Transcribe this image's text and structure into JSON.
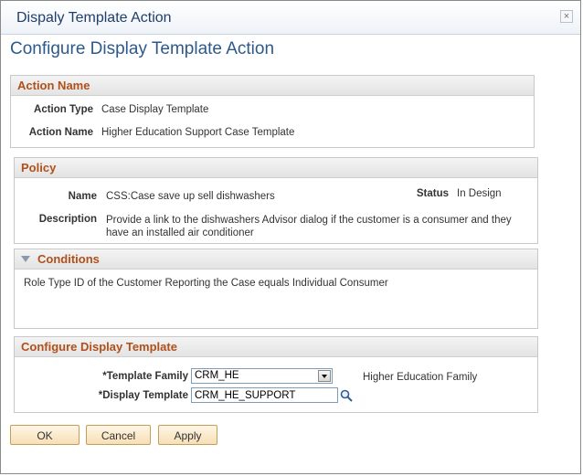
{
  "window": {
    "title": "Dispaly Template Action",
    "close_glyph": "×"
  },
  "page": {
    "title": "Configure Display Template Action"
  },
  "action_name_section": {
    "header": "Action Name",
    "action_type_label": "Action Type",
    "action_type_value": "Case Display Template",
    "action_name_label": "Action Name",
    "action_name_value": "Higher Education Support Case Template"
  },
  "policy_section": {
    "header": "Policy",
    "name_label": "Name",
    "name_value": "CSS:Case save up sell dishwashers",
    "status_label": "Status",
    "status_value": "In Design",
    "description_label": "Description",
    "description_value": "Provide a link to the dishwashers Advisor dialog if the customer is a consumer and they have an installed air conditioner"
  },
  "conditions_section": {
    "header": "Conditions",
    "text": "Role Type ID of the Customer Reporting the Case equals Individual Consumer"
  },
  "configure_section": {
    "header": "Configure Display Template",
    "template_family_label": "*Template Family",
    "template_family_value": "CRM_HE",
    "template_family_description": "Higher Education Family",
    "display_template_label": "*Display Template",
    "display_template_value": "CRM_HE_SUPPORT"
  },
  "buttons": {
    "ok": "OK",
    "cancel": "Cancel",
    "apply": "Apply"
  },
  "icons": {
    "close": "close-icon",
    "dropdown": "chevron-down-icon",
    "lookup": "search-icon",
    "collapse": "triangle-down-icon"
  },
  "colors": {
    "section_header_text": "#b0501a",
    "title_text": "#2d5a8c",
    "button_bg": "#f6dfb5"
  }
}
